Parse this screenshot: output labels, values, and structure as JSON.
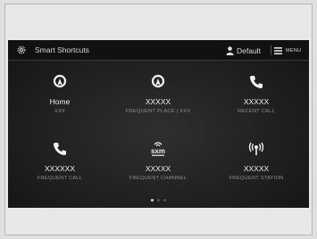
{
  "header": {
    "title": "Smart Shortcuts",
    "profile_label": "Default",
    "menu_label": "MENU"
  },
  "tiles": [
    {
      "icon": "navigation-icon",
      "main": "Home",
      "sub": "XXX"
    },
    {
      "icon": "navigation-icon",
      "main": "XXXXX",
      "sub": "FREQUENT PLACE | XXX"
    },
    {
      "icon": "phone-icon",
      "main": "XXXXX",
      "sub": "RECENT CALL"
    },
    {
      "icon": "phone-icon",
      "main": "XXXXXX",
      "sub": "FREQUENT CALL"
    },
    {
      "icon": "sxm-icon",
      "main": "XXXXX",
      "sub": "FREQUENT CHANNEL"
    },
    {
      "icon": "radio-broadcast-icon",
      "main": "XXXXX",
      "sub": "FREQUENT STATION"
    }
  ],
  "pager": {
    "pages": 3,
    "active": 1
  },
  "colors": {
    "screen_bg": "#1e1e1e",
    "text": "#f0f0f0",
    "subtext": "#8d8d8d"
  }
}
